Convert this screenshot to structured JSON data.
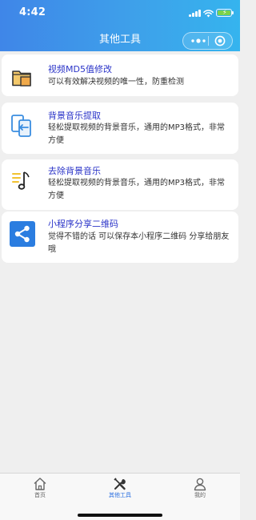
{
  "status_bar": {
    "time": "4:42"
  },
  "nav": {
    "title": "其他工具"
  },
  "tools": [
    {
      "title": "视频MD5值修改",
      "desc": "可以有效解决视频的唯一性，防重检测",
      "icon": "folder-icon"
    },
    {
      "title": "背景音乐提取",
      "desc": "轻松提取视频的背景音乐，通用的MP3格式，非常方便",
      "icon": "extract-audio-icon"
    },
    {
      "title": "去除背景音乐",
      "desc": "轻松提取视频的背景音乐，通用的MP3格式，非常方便",
      "icon": "music-note-icon"
    },
    {
      "title": "小程序分享二维码",
      "desc": "觉得不错的话 可以保存本小程序二维码 分享给朋友哦",
      "icon": "share-icon"
    }
  ],
  "tabbar": [
    {
      "label": "首页",
      "icon": "home-icon",
      "active": false
    },
    {
      "label": "其他工具",
      "icon": "tools-icon",
      "active": true
    },
    {
      "label": "我的",
      "icon": "user-icon",
      "active": false
    }
  ],
  "colors": {
    "header_start": "#3f86e8",
    "header_end": "#35b4ee",
    "title_blue": "#2b34c8",
    "tab_active": "#2b6fe0"
  }
}
